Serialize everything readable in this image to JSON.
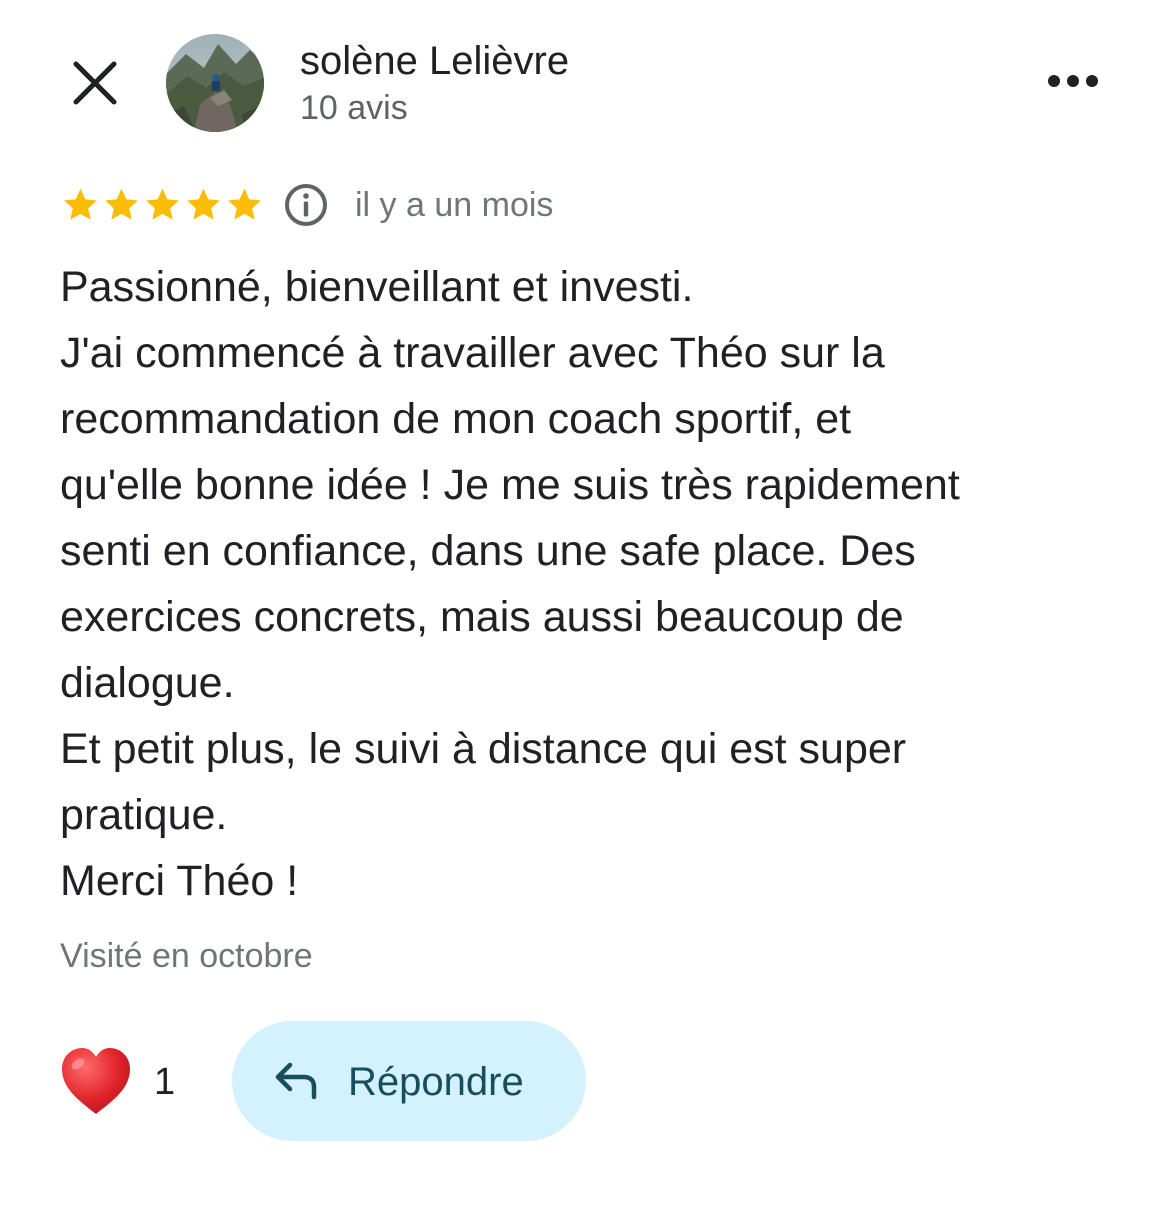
{
  "header": {
    "close_icon": "close-icon",
    "author_name": "solène Lelièvre",
    "review_count": "10 avis",
    "more_icon": "more-horizontal-icon"
  },
  "review": {
    "rating": 5,
    "rating_max": 5,
    "star_color": "#fbbc04",
    "info_icon": "info-icon",
    "time_ago": "il y a un mois",
    "lines": [
      "Passionné, bienveillant et investi.",
      "J'ai commencé à travailler avec Théo sur la",
      "recommandation de mon coach sportif, et",
      "qu'elle bonne idée ! Je me suis très rapidement",
      "senti en confiance, dans une safe place. Des",
      "exercices concrets, mais aussi beaucoup de",
      "dialogue.",
      "Et petit plus, le suivi à distance qui est super",
      "pratique.",
      "Merci Théo !"
    ],
    "visited": "Visité en octobre"
  },
  "actions": {
    "like_icon": "heart-icon",
    "like_count": "1",
    "reply_icon": "reply-arrow-icon",
    "reply_label": "Répondre",
    "reply_bg_color": "#d3f2fd",
    "reply_text_color": "#174d5e"
  }
}
